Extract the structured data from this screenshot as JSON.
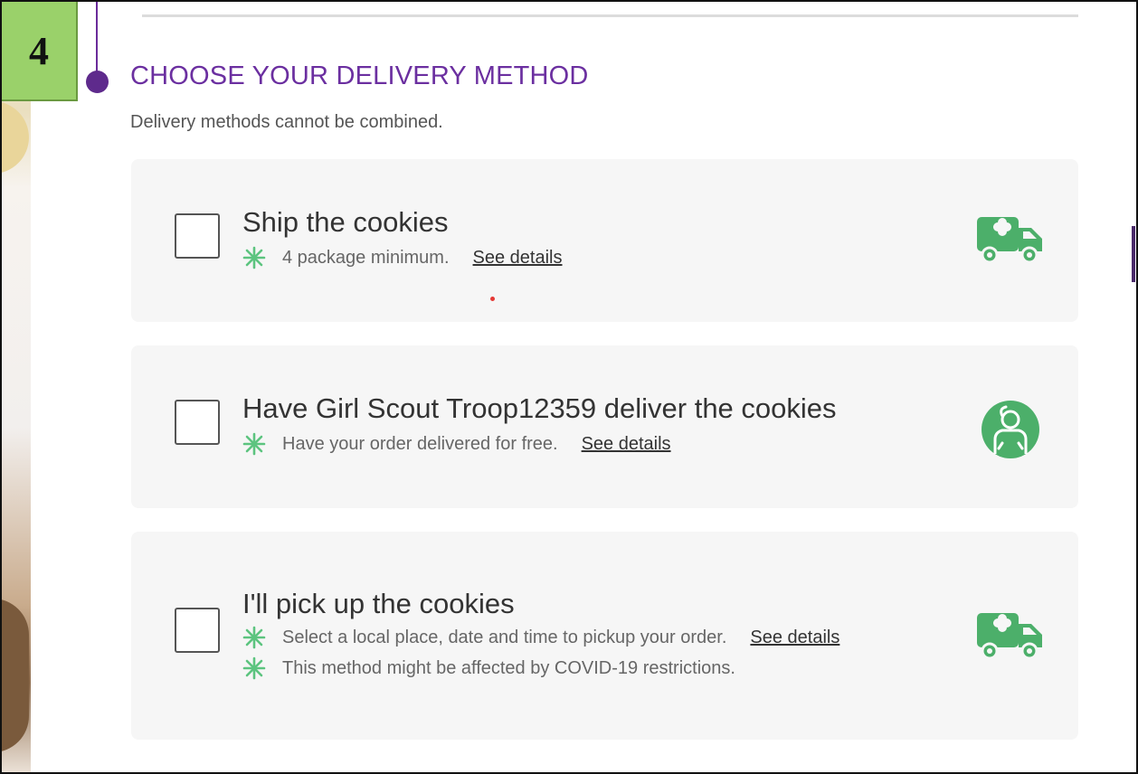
{
  "step": {
    "number": "4"
  },
  "section": {
    "title": "CHOOSE YOUR DELIVERY METHOD",
    "subtitle": "Delivery methods cannot be combined."
  },
  "options": [
    {
      "title": "Ship the cookies",
      "lines": [
        {
          "text": "4 package minimum.",
          "link": "See details"
        }
      ],
      "icon": "truck-icon"
    },
    {
      "title": "Have Girl Scout Troop12359 deliver the cookies",
      "lines": [
        {
          "text": "Have your order delivered for free.",
          "link": "See details"
        }
      ],
      "icon": "girl-scout-icon"
    },
    {
      "title": "I'll pick up the cookies",
      "lines": [
        {
          "text": "Select a local place, date and time to pickup your order.",
          "link": "See details"
        },
        {
          "text": "This method might be affected by COVID-19 restrictions."
        }
      ],
      "icon": "truck-icon"
    }
  ],
  "colors": {
    "accent_purple": "#6b2fa0",
    "icon_green": "#4caf6a",
    "bullet_green": "#5cc47f",
    "badge_green": "#9ad16a",
    "card_bg": "#f6f6f6"
  }
}
